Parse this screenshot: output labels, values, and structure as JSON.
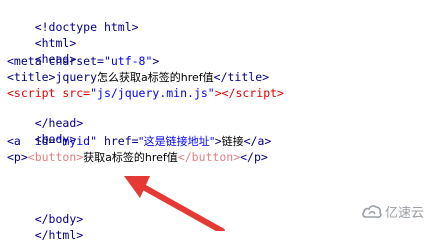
{
  "code_lines": {
    "l1": "<!doctype html>",
    "l2": "<html>",
    "l3": "<head>",
    "l4_a": "<meta charset=",
    "l4_b": "\"utf-8\"",
    "l4_c": ">",
    "l5_a": "<title>",
    "l5_b": "jquery",
    "l5_c": "怎么获取a标签的href值",
    "l5_d": "</title>",
    "l6_a": "<script src=",
    "l6_b": "\"js/jquery.min.js\"",
    "l6_c": "></",
    "l6_d": "script",
    "l6_e": ">",
    "l7": "</head>",
    "l8": "<body>",
    "l9_a": "<a  id=",
    "l9_b": "\"myid\"",
    "l9_c": " href=",
    "l9_d": "\"这是链接地址\"",
    "l9_e": ">",
    "l9_f": "链接",
    "l9_g": "</a>",
    "l10_a": "<p>",
    "l10_b": "<button>",
    "l10_c": "获取a标签的href值",
    "l10_d": "</button>",
    "l10_e": "</p>",
    "l11": "",
    "l12": "",
    "l13": "</body>",
    "l14": "</html>"
  },
  "watermark": {
    "text": "亿速云"
  },
  "colors": {
    "tag": "#000080",
    "attr_value": "#0000ff",
    "arrow": "#e53935"
  }
}
